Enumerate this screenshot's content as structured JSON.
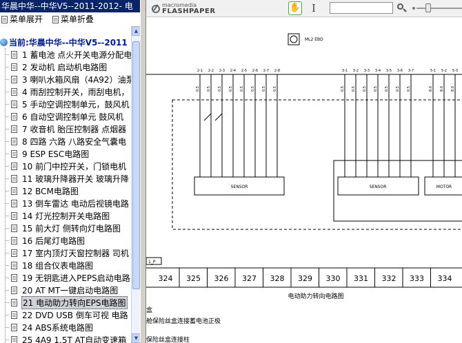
{
  "window": {
    "title": "华晨中华--中华V5--2011-2012- 电"
  },
  "menu": {
    "expand": "菜单展开",
    "collapse": "菜单折叠"
  },
  "tree": {
    "root": "当前:华晨中华--中华V5--2011",
    "items": [
      "1 蓄电池 点火开关电源分配电",
      "2 发动机 启动机电路图",
      "3 喇叭水箱风扇（4A92）油泵",
      "4 雨刮控制开关，雨刮电机，",
      "5 手动空调控制单元，鼓风机",
      "6 自动空调控制单元 鼓风机",
      "7 收音机 胎压控制器 点烟器",
      "8 四路 六路 八路安全气囊电",
      "9 ESP ESC电路图",
      "10 前门中控开关，门锁电机",
      "11 玻璃升降器开关 玻璃升降",
      "12 BCM电路图",
      "13 倒车雷达 电动后视镜电路",
      "14 灯光控制开关电路图",
      "15 前大灯 侧转向灯电路图",
      "16 后尾灯电路图",
      "17 室内顶灯天窗控制器 司机",
      "18 组合仪表电路图",
      "19 无钥匙进入PEPS启动电路",
      "20 AT MT一键启动电路图",
      "21 电动助力转向EPS电路图",
      "22 DVD USB 倒车可视 电路",
      "24 ABS系统电路图",
      "25 4A9 1.5T AT自动变速箱"
    ],
    "selected_index": 20
  },
  "viewer": {
    "logo_line1": "macromedia",
    "logo_line2": "FLASHPAPER",
    "find_value": "",
    "zoom_level": 0.25
  },
  "diagram": {
    "header_label": "ML2  EBD",
    "left_pins": [
      "2-1",
      "2-2",
      "2-3",
      "2-4",
      "2-5",
      "2-6",
      "2-7",
      "2-8"
    ],
    "right_pins": [
      "3-1",
      "3-2",
      "3-3",
      "3-4",
      "3-5",
      "3-6",
      "3-7"
    ],
    "motor_pins": [
      "5-1",
      "5-2",
      "5-3"
    ],
    "wire_sizes_left": [
      "0.5",
      "0.5",
      "0.5",
      "0.5",
      "0.5",
      "0.5",
      "0.5",
      "0.5"
    ],
    "wire_sizes_right": [
      "0.5",
      "0.5",
      "0.5",
      "0.5",
      "0.5",
      "0.5",
      "0.5"
    ],
    "wire_sizes_motor": [
      "8.0",
      "8.0",
      "8.0"
    ],
    "box_labels": [
      "SENSOR",
      "SENSOR",
      "MOTOR"
    ],
    "small_tag": "1_P",
    "ruler": [
      "324",
      "325",
      "326",
      "327",
      "328",
      "329",
      "330",
      "331",
      "332",
      "333",
      "334"
    ],
    "caption": "电动助力转向电路图",
    "notes": [
      "盒",
      "舱保险丝盒连接蓄电池正极",
      "保险丝盒连接柱"
    ]
  }
}
